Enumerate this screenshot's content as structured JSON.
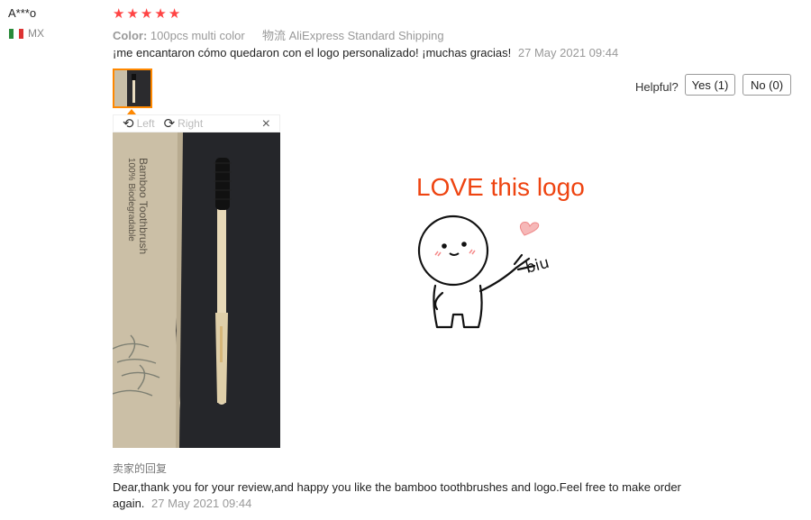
{
  "user": {
    "name": "A***o",
    "country": "MX"
  },
  "rating": {
    "stars": 5
  },
  "meta": {
    "color_label": "Color:",
    "color_value": "100pcs multi color",
    "shipping_label": "物流",
    "shipping_value": "AliExpress Standard Shipping"
  },
  "review": {
    "text": "¡me encantaron cómo quedaron con el logo personalizado! ¡muchas gracias!",
    "date": "27 May 2021 09:44"
  },
  "helpful": {
    "label": "Helpful?",
    "yes": "Yes (1)",
    "no": "No (0)"
  },
  "viewer": {
    "rotate_left": "Left",
    "rotate_right": "Right",
    "close": "×"
  },
  "photo": {
    "package_title": "Bamboo Toothbrush",
    "package_subtitle": "100% Biodegradable"
  },
  "overlay": {
    "text": "LOVE this logo",
    "sticker_text": "biu"
  },
  "seller_reply": {
    "title": "卖家的回复",
    "text": "Dear,thank you for your review,and happy you like the bamboo toothbrushes and logo.Feel free to make order again.",
    "date": "27 May 2021 09:44"
  },
  "colors": {
    "star": "#ff4444",
    "thumb_border": "#ff8800",
    "overlay_text": "#e41111"
  }
}
